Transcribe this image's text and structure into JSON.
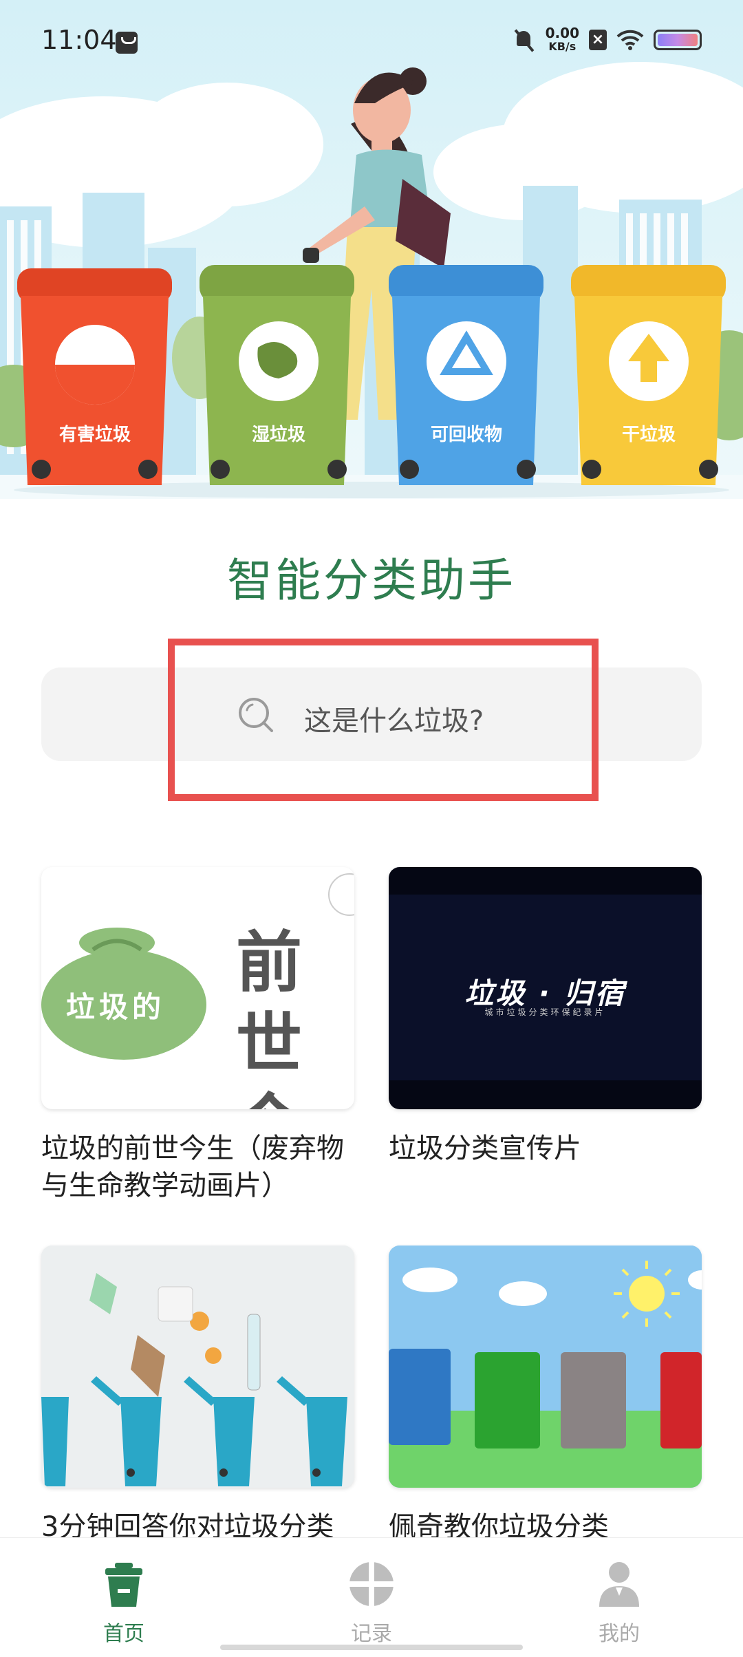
{
  "status_bar": {
    "time": "11:04",
    "net_speed": "0.00",
    "net_unit": "KB/s",
    "icons": [
      "message-icon",
      "bell-off-icon",
      "sim-x-icon",
      "wifi-icon",
      "battery-icon"
    ]
  },
  "banner": {
    "bins": [
      {
        "label": "有害垃圾",
        "color": "#f0512f"
      },
      {
        "label": "湿垃圾",
        "color": "#8db54f"
      },
      {
        "label": "可回收物",
        "color": "#4fa3e6"
      },
      {
        "label": "干垃圾",
        "color": "#f8c93a"
      }
    ]
  },
  "app_title": "智能分类助手",
  "search": {
    "placeholder": "这是什么垃圾?"
  },
  "videos": [
    {
      "title": "垃圾的前世今生（废弃物与生命教学动画片）",
      "thumb_big_text": "前世今生",
      "thumb_bag_text": "垃圾的"
    },
    {
      "title": "垃圾分类宣传片",
      "thumb_logo_text": "垃圾 · 归宿",
      "thumb_sub_text": "城市垃圾分类环保纪录片"
    },
    {
      "title": "3分钟回答你对垃圾分类"
    },
    {
      "title": "佩奇教你垃圾分类"
    }
  ],
  "bottom_nav": [
    {
      "label": "首页",
      "active": true
    },
    {
      "label": "记录",
      "active": false
    },
    {
      "label": "我的",
      "active": false
    }
  ],
  "colors": {
    "brand_green": "#2e7d4f",
    "highlight_red": "#e8514f"
  }
}
